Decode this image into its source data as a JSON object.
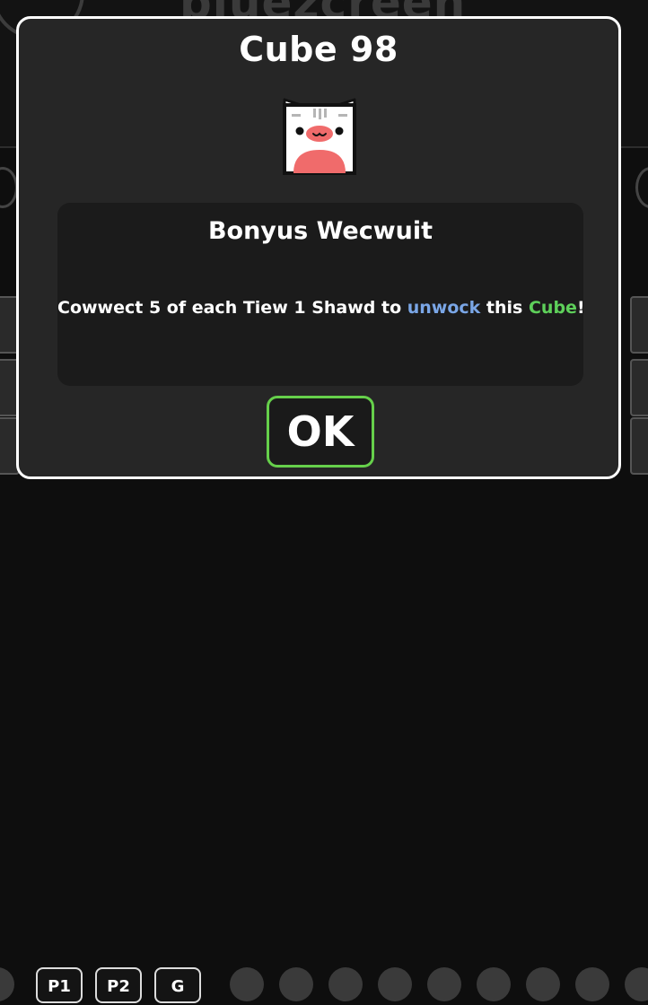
{
  "background": {
    "title_partial": "bluezcreen",
    "bottom_buttons": [
      {
        "label": "P1"
      },
      {
        "label": "P2"
      },
      {
        "label": "G"
      }
    ]
  },
  "modal": {
    "title": "Cube 98",
    "icon": "white-cat-cube-icon",
    "panel": {
      "heading": "Bonyus Wecwuit",
      "desc_prefix": "Cowwect 5 of each Tiew 1 Shawd to ",
      "desc_link": "unwock",
      "desc_mid": " this ",
      "desc_cube": "Cube",
      "desc_suffix": "!"
    },
    "ok_label": "OK"
  },
  "colors": {
    "ok_border": "#66d04b",
    "highlight_blue": "#7aa6e6",
    "highlight_green": "#5ed05a"
  }
}
